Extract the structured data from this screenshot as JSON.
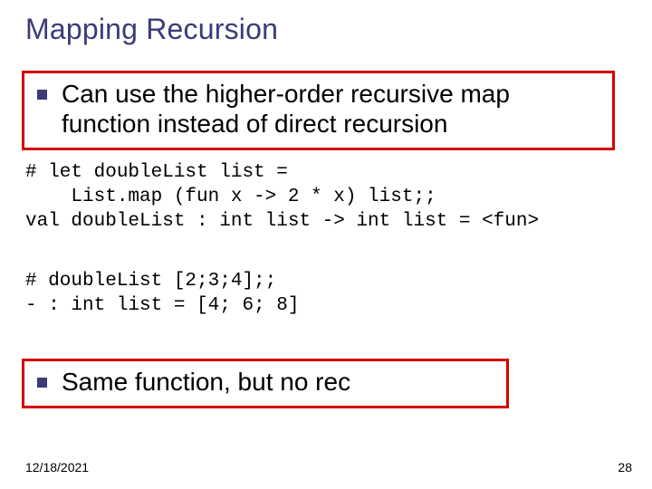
{
  "title": "Mapping Recursion",
  "bullets": {
    "b1": "Can use the higher-order recursive map function instead of direct recursion",
    "b2": "Same function, but no rec"
  },
  "code": {
    "block1": "# let doubleList list =\n    List.map (fun x -> 2 * x) list;;\nval doubleList : int list -> int list = <fun>",
    "block2": "# doubleList [2;3;4];;\n- : int list = [4; 6; 8]"
  },
  "footer": {
    "date": "12/18/2021",
    "page": "28"
  }
}
